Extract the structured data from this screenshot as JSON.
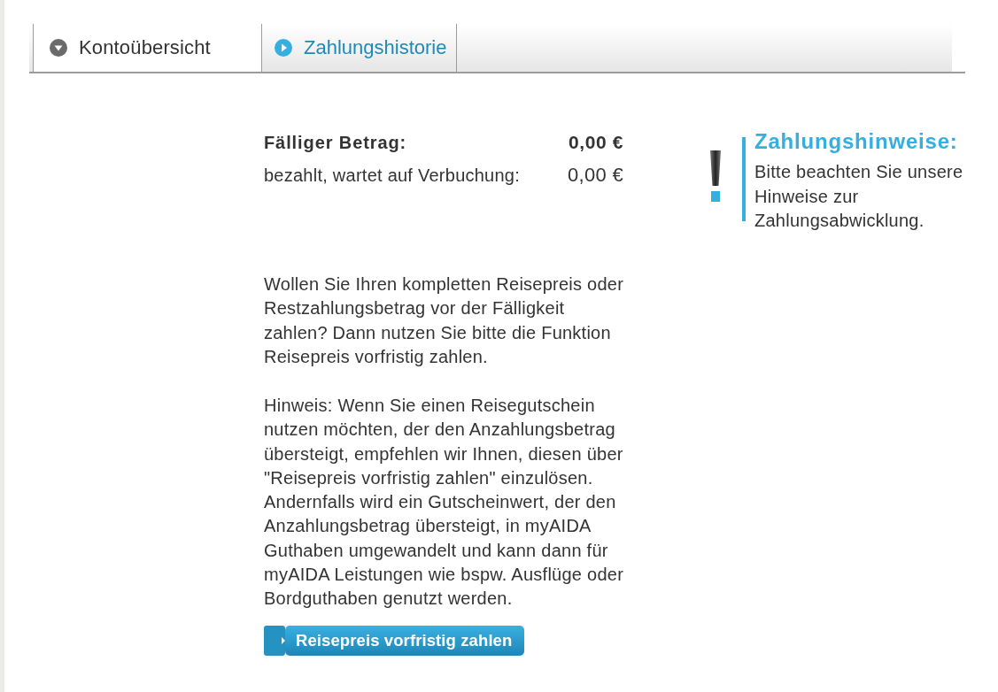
{
  "tabs": [
    {
      "label": "Kontoübersicht",
      "selected": true
    },
    {
      "label": "Zahlungshistorie",
      "selected": false
    }
  ],
  "summary": [
    {
      "kind": "total",
      "label": "Fälliger Betrag:",
      "value": "0,00 €"
    },
    {
      "kind": "pending",
      "label": "bezahlt, wartet auf Verbuchung:",
      "value": "0,00 €"
    }
  ],
  "paragraphs": [
    "Wollen Sie Ihren kompletten Reisepreis oder Restzahlungsbetrag vor der Fälligkeit zahlen? Dann nutzen Sie bitte die Funktion Reisepreis vorfristig zahlen.",
    "Hinweis: Wenn Sie einen Reisegutschein nutzen möchten, der den Anzahlungsbetrag übersteigt, empfehlen wir Ihnen, diesen über \"Reisepreis vorfristig zahlen\" einzulösen. Andernfalls wird ein Gutscheinwert, der den Anzahlungsbetrag übersteigt, in myAIDA Guthaben umgewandelt und kann dann für myAIDA Leistungen wie bspw. Ausflüge oder Bordguthaben genutzt werden."
  ],
  "button": {
    "label": "Reisepreis vorfristig zahlen"
  },
  "notice": {
    "title": "Zahlungshinweise:",
    "text": "Bitte beachten Sie unsere Hinweise zur Zahlungsabwicklung."
  }
}
